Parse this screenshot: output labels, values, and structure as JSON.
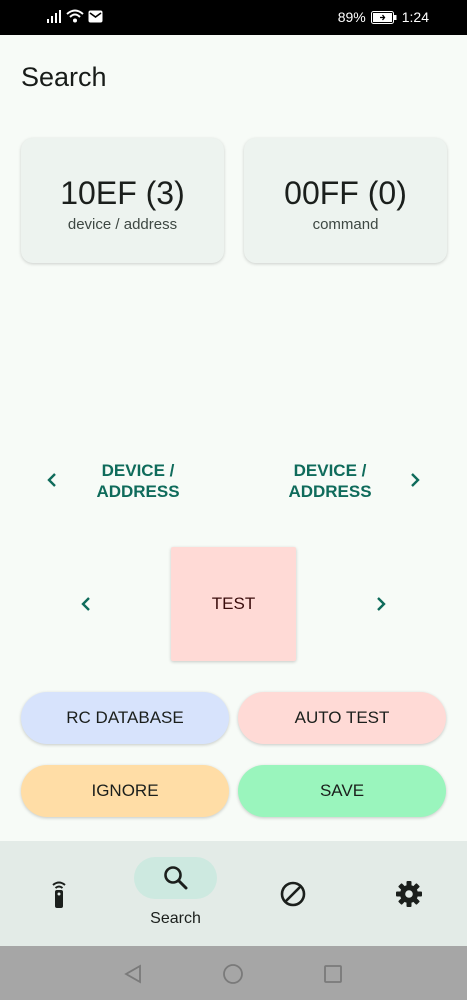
{
  "status_bar": {
    "battery": "89%",
    "time": "1:24"
  },
  "header": {
    "title": "Search"
  },
  "cards": [
    {
      "value": "10EF (3)",
      "label": "device / address"
    },
    {
      "value": "00FF (0)",
      "label": "command"
    }
  ],
  "device_nav": {
    "prev_label": "DEVICE / ADDRESS",
    "next_label": "DEVICE / ADDRESS"
  },
  "test_button": "TEST",
  "actions": {
    "rc_database": "RC DATABASE",
    "auto_test": "AUTO TEST",
    "ignore": "IGNORE",
    "save": "SAVE"
  },
  "colors": {
    "accent": "#0f6b5b",
    "rc_database_bg": "#d7e3fc",
    "auto_test_bg": "#ffdad6",
    "ignore_bg": "#ffdda6",
    "save_bg": "#9af5bd"
  },
  "bottom_nav": {
    "items": [
      {
        "icon": "remote-icon",
        "label": ""
      },
      {
        "icon": "search-icon",
        "label": "Search"
      },
      {
        "icon": "block-icon",
        "label": ""
      },
      {
        "icon": "gear-icon",
        "label": ""
      }
    ]
  }
}
